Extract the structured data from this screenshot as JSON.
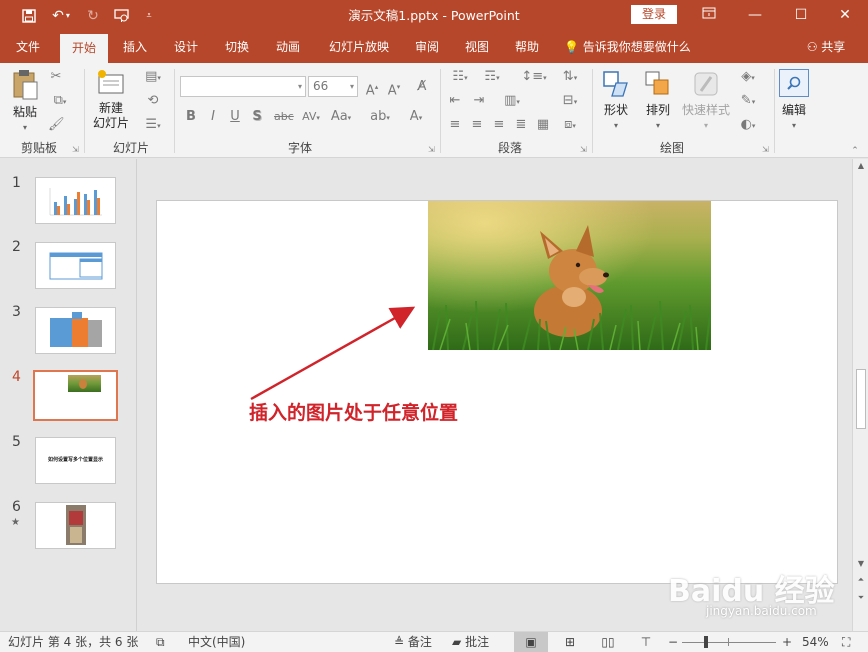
{
  "app": {
    "title": "演示文稿1.pptx - PowerPoint",
    "login_label": "登录"
  },
  "tabs": [
    {
      "label": "文件"
    },
    {
      "label": "开始"
    },
    {
      "label": "插入"
    },
    {
      "label": "设计"
    },
    {
      "label": "切换"
    },
    {
      "label": "动画"
    },
    {
      "label": "幻灯片放映"
    },
    {
      "label": "审阅"
    },
    {
      "label": "视图"
    },
    {
      "label": "帮助"
    },
    {
      "label": "告诉我你想要做什么"
    }
  ],
  "share_label": "共享",
  "ribbon": {
    "paste_label": "粘贴",
    "new_slide_line1": "新建",
    "new_slide_line2": "幻灯片",
    "font_size_value": "66",
    "shape_label": "形状",
    "arrange_label": "排列",
    "quick_style_label": "快速样式",
    "edit_label": "编辑",
    "groups": {
      "clipboard": "剪贴板",
      "slides": "幻灯片",
      "font": "字体",
      "paragraph": "段落",
      "drawing": "绘图"
    },
    "font_buttons": [
      "B",
      "I",
      "U",
      "S",
      "AV",
      "Aa",
      "A"
    ]
  },
  "thumbnails": [
    {
      "number": "1"
    },
    {
      "number": "2"
    },
    {
      "number": "3"
    },
    {
      "number": "4"
    },
    {
      "number": "5",
      "text": "如何设置写多个位置显示"
    },
    {
      "number": "6"
    }
  ],
  "slide": {
    "caption": "插入的图片处于任意位置"
  },
  "status": {
    "slide_info": "幻灯片 第 4 张，共 6 张",
    "language": "中文(中国)",
    "notes_label": "备注",
    "comments_label": "批注",
    "zoom_value": "54%"
  },
  "watermark": {
    "brand": "Baidu 经验",
    "url": "jingyan.baidu.com"
  },
  "colors": {
    "accent": "#b7472a",
    "caption_red": "#d0232a",
    "active_thumb_border": "#e0764f"
  }
}
